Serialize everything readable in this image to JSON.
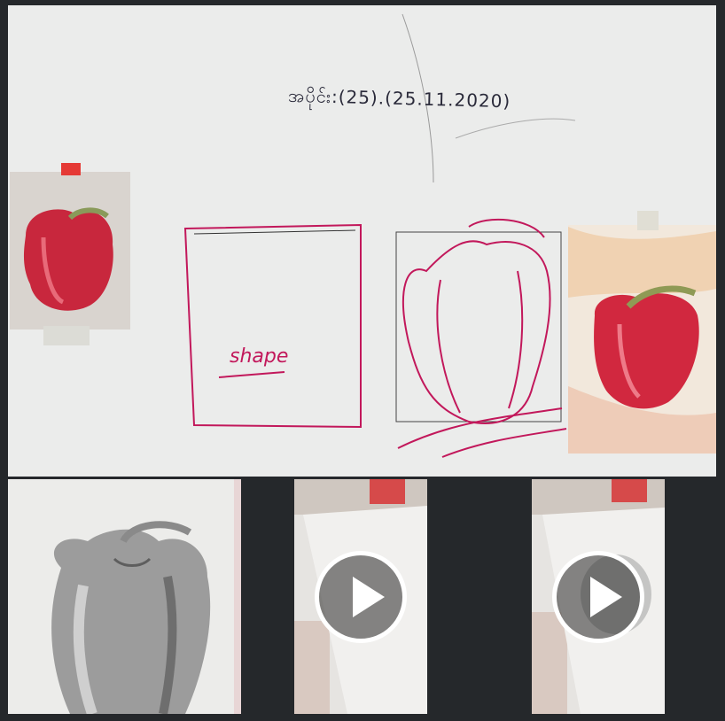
{
  "board": {
    "date_caption": "အပိုင်း:(25).(25.11.2020)",
    "shape_label": "shape"
  },
  "thumbnails": [
    {
      "kind": "photo",
      "name": "pencil-sketch"
    },
    {
      "kind": "video",
      "name": "video-1",
      "icon": "play-icon"
    },
    {
      "kind": "video",
      "name": "video-2",
      "icon": "play-icon"
    }
  ],
  "colors": {
    "background": "#25282b",
    "whiteboard": "#eeefee",
    "marker": "#c2185b",
    "pepper": "#c8273d"
  }
}
